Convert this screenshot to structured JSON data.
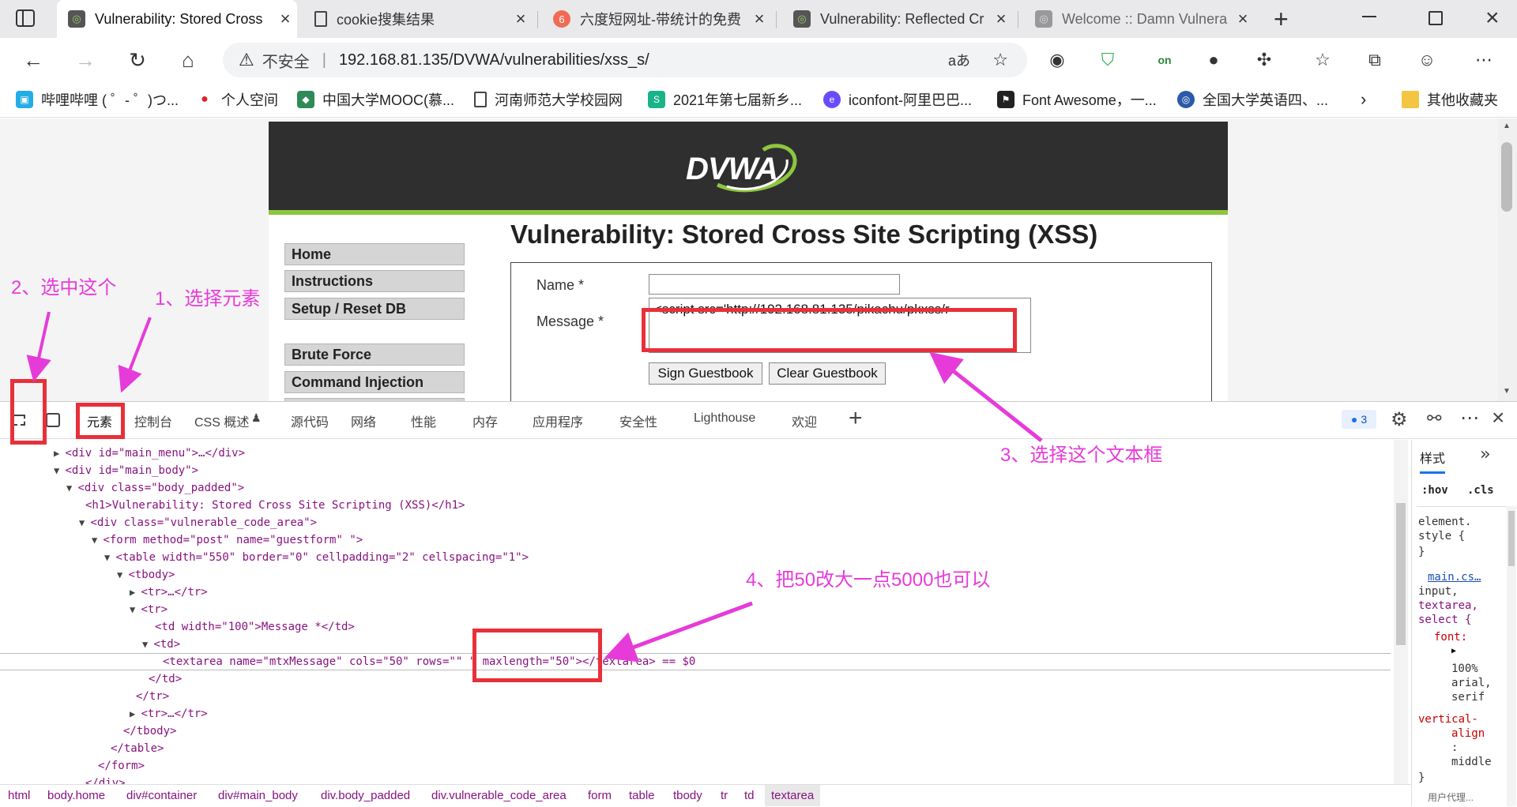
{
  "tabs": [
    {
      "title": "Vulnerability: Stored Cross",
      "active": true
    },
    {
      "title": "cookie搜集结果"
    },
    {
      "title": "六度短网址-带统计的免费"
    },
    {
      "title": "Vulnerability: Reflected Cr"
    },
    {
      "title": "Welcome :: Damn Vulnera"
    }
  ],
  "address": {
    "security": "不安全",
    "url": "192.168.81.135/DVWA/vulnerabilities/xss_s/",
    "read_aloud": "aあ"
  },
  "bookmarks": [
    "哔哩哔哩 ( ゜- ゜)つ...",
    "个人空间",
    "中国大学MOOC(慕...",
    "河南师范大学校园网",
    "2021年第七届新乡...",
    "iconfont-阿里巴巴...",
    "Font Awesome，一...",
    "全国大学英语四、...",
    "其他收藏夹"
  ],
  "page": {
    "logo": "DVWA",
    "heading": "Vulnerability: Stored Cross Site Scripting (XSS)",
    "menu": [
      "Home",
      "Instructions",
      "Setup / Reset DB",
      "Brute Force",
      "Command Injection"
    ],
    "form": {
      "name_label": "Name *",
      "message_label": "Message *",
      "message_value": "<script src='http://192.168.81.135/pikachu/pkxss/r",
      "sign_button": "Sign Guestbook",
      "clear_button": "Clear Guestbook"
    }
  },
  "devtools": {
    "tabs": [
      "元素",
      "控制台",
      "CSS 概述",
      "源代码",
      "网络",
      "性能",
      "内存",
      "应用程序",
      "安全性",
      "Lighthouse",
      "欢迎"
    ],
    "issue_count": "3",
    "styles_tab": "样式",
    "styles_filters": [
      ":hov",
      ".cls"
    ],
    "styles_rules": [
      "element.",
      "style {",
      "}",
      "main.cs…",
      "input,",
      "textarea,",
      "select {",
      "font:",
      "100%",
      "arial,",
      "serif",
      "vertical-",
      "align",
      ":",
      "middle",
      "}",
      "用户代理..."
    ],
    "dom_lines": [
      "<div id=\"main_menu\">…</div>",
      "<div id=\"main_body\">",
      "<div class=\"body_padded\">",
      "<h1>Vulnerability: Stored Cross Site Scripting (XSS)</h1>",
      "<div class=\"vulnerable_code_area\">",
      "<form method=\"post\" name=\"guestform\" \">",
      "<table width=\"550\" border=\"0\" cellpadding=\"2\" cellspacing=\"1\">",
      "<tbody>",
      "<tr>…</tr>",
      "<tr>",
      "<td width=\"100\">Message *</td>",
      "<td>",
      "<textarea name=\"mtxMessage\" cols=\"50\" rows=\"\" \" maxlength=\"50\"></textarea> == $0",
      "</td>",
      "</tr>",
      "<tr>…</tr>",
      "</tbody>",
      "</table>",
      "</form>",
      "</div>"
    ],
    "breadcrumbs": [
      "html",
      "body.home",
      "div#container",
      "div#main_body",
      "div.body_padded",
      "div.vulnerable_code_area",
      "form",
      "table",
      "tbody",
      "tr",
      "td",
      "textarea"
    ]
  },
  "annotations": {
    "a1": "1、选择元素",
    "a2": "2、选中这个",
    "a3": "3、选择这个文本框",
    "a4": "4、把50改大一点5000也可以"
  },
  "colors": {
    "annotation": "#e63bd9",
    "highlight_box": "#e8303a",
    "dvwa_green": "#8dc63f"
  }
}
